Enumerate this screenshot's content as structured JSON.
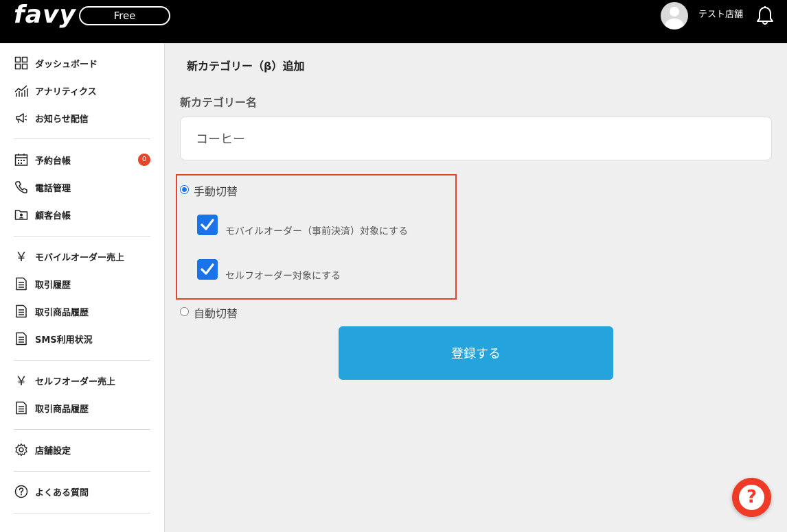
{
  "header": {
    "logo_text": "favy",
    "plan": "Free",
    "store_name": "テスト店舗"
  },
  "sidebar": {
    "items": [
      {
        "label": "ダッシュボード",
        "icon": "grid-icon"
      },
      {
        "label": "アナリティクス",
        "icon": "analytics-icon"
      },
      {
        "label": "お知らせ配信",
        "icon": "megaphone-icon"
      },
      {
        "label": "予約台帳",
        "icon": "calendar-icon",
        "badge": "0"
      },
      {
        "label": "電話管理",
        "icon": "phone-icon"
      },
      {
        "label": "顧客台帳",
        "icon": "customer-folder-icon"
      },
      {
        "label": "モバイルオーダー売上",
        "icon": "yen-icon"
      },
      {
        "label": "取引履歴",
        "icon": "document-icon"
      },
      {
        "label": "取引商品履歴",
        "icon": "document-icon"
      },
      {
        "label": "SMS利用状況",
        "icon": "document-icon"
      },
      {
        "label": "セルフオーダー売上",
        "icon": "yen-icon"
      },
      {
        "label": "取引商品履歴",
        "icon": "document-icon"
      },
      {
        "label": "店舗設定",
        "icon": "gear-icon"
      },
      {
        "label": "よくある質問",
        "icon": "question-icon"
      }
    ],
    "yen_symbol": "￥"
  },
  "main": {
    "title": "新カテゴリー（β）追加",
    "field_label": "新カテゴリー名",
    "category_name_value": "コーヒー",
    "manual_switch_label": "手動切替",
    "manual_switch_checked": true,
    "mobile_order_label": "モバイルオーダー（事前決済）対象にする",
    "self_order_label": "セルフオーダー対象にする",
    "auto_switch_label": "自動切替",
    "submit_label": "登録する"
  },
  "colors": {
    "header_bg": "#000000",
    "accent_blue": "#24a3dc",
    "checkbox_blue": "#1a73e8",
    "highlight_red": "#e8442c",
    "help_red": "#ef3b26"
  },
  "help_button": {
    "glyph": "?"
  }
}
